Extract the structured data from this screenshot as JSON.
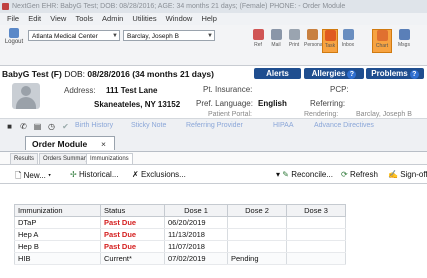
{
  "window": {
    "title": "NextGen EHR: BabyG Test; DOB: 08/28/2016; AGE: 34 months 21 days; (Female) PHONE: - Order Module"
  },
  "menu": [
    "File",
    "Edit",
    "View",
    "Tools",
    "Admin",
    "Utilities",
    "Window",
    "Help"
  ],
  "toolbar": {
    "logout_label": "Logout",
    "location_value": "Atlanta Medical Center",
    "provider_value": "Barclay, Joseph B",
    "buttons": [
      "Ref",
      "Mail",
      "Print",
      "Personal",
      "Task",
      "Inbox",
      "Chart",
      "Msgs"
    ]
  },
  "patient": {
    "name": "BabyG Test  (F)",
    "dob_label": "DOB:",
    "dob_value": "08/28/2016 (34 months 21 days)",
    "alerts_label": "Alerts",
    "allergies_label": "Allergies",
    "problems_label": "Problems",
    "address_label": "Address:",
    "address_line1": "111 Test Lane",
    "address_line2": "Skaneateles, NY 13152",
    "pt_insurance_label": "Pt. Insurance:",
    "pref_language_label": "Pref. Language:",
    "pref_language_value": "English",
    "patient_portal_label": "Patient Portal:",
    "pcp_label": "PCP:",
    "referring_label": "Referring:",
    "rendering_label": "Rendering:",
    "rendering_value": "Barclay, Joseph B"
  },
  "links": [
    "Birth History",
    "Sticky Note",
    "Referring Provider",
    "HIPAA",
    "Advance Directives"
  ],
  "tabs": {
    "order_module": "Order Module",
    "close": "×"
  },
  "subtabs": [
    "Results",
    "Orders Summary",
    "Immunizations"
  ],
  "actions": {
    "new": "New...",
    "historical": "Historical...",
    "exclusions": "Exclusions...",
    "reconcile": "Reconcile...",
    "refresh": "Refresh",
    "signoff": "Sign-off"
  },
  "grid": {
    "columns": [
      "Immunization",
      "Status",
      "Dose 1",
      "Dose 2",
      "Dose 3"
    ],
    "rows": [
      {
        "immunization": "DTaP",
        "status": "Past Due",
        "dose1": "06/20/2019",
        "dose2": "",
        "dose3": ""
      },
      {
        "immunization": "Hep A",
        "status": "Past Due",
        "dose1": "11/13/2018",
        "dose2": "",
        "dose3": ""
      },
      {
        "immunization": "Hep B",
        "status": "Past Due",
        "dose1": "11/07/2018",
        "dose2": "",
        "dose3": ""
      },
      {
        "immunization": "HIB",
        "status": "Current*",
        "dose1": "07/02/2019",
        "dose2": "Pending",
        "dose3": ""
      }
    ]
  },
  "colors": {
    "alert_pill": "#1f4e8f",
    "past_due": "#d41e1e",
    "link": "#8aa6d8",
    "task_highlight": "#f7a341"
  }
}
